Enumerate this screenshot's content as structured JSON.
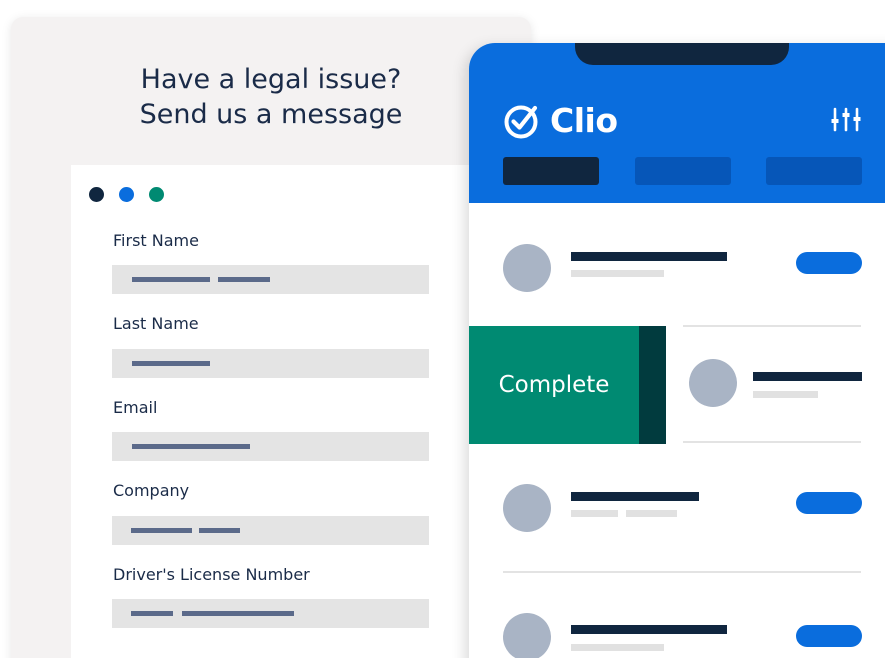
{
  "form": {
    "title_line1": "Have a legal issue?",
    "title_line2": "Send us a message",
    "window_dots": [
      "#10263f",
      "#0a6ddd",
      "#008a72"
    ],
    "fields": [
      {
        "label": "First Name"
      },
      {
        "label": "Last Name"
      },
      {
        "label": "Email"
      },
      {
        "label": "Company"
      },
      {
        "label": "Driver's License Number"
      }
    ]
  },
  "app": {
    "brand": "Clio",
    "logo_icon": "check-circle-icon",
    "settings_icon": "sliders-icon",
    "swipe_action_label": "Complete",
    "colors": {
      "brand_blue": "#0a6ddd",
      "navy": "#10263f",
      "complete_green": "#008a72",
      "complete_edge": "#013b3e"
    }
  }
}
